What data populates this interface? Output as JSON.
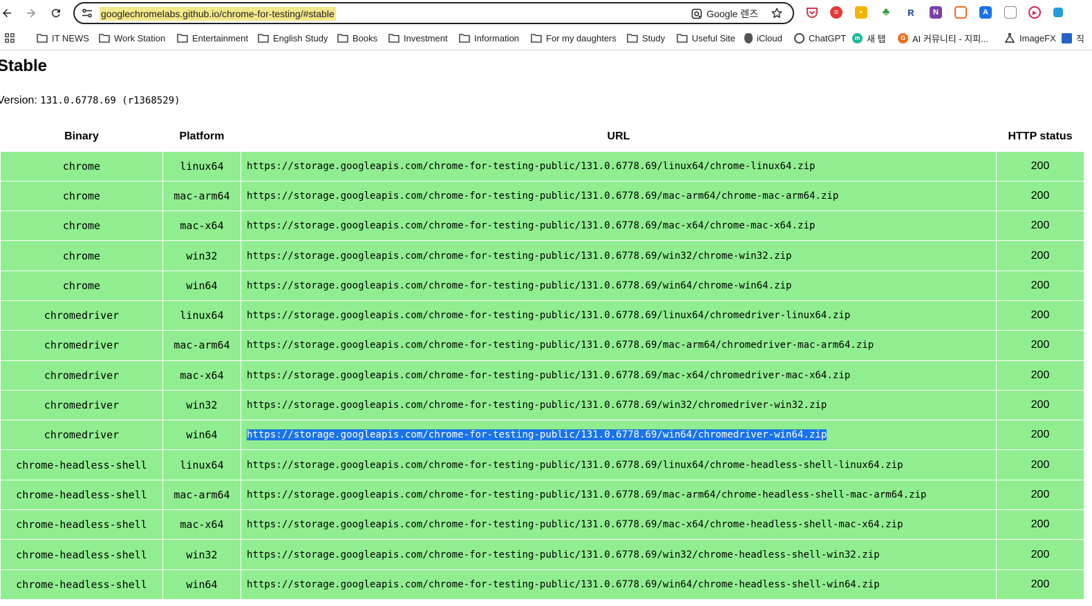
{
  "browser": {
    "address_bar": {
      "url": "googlechromelabs.github.io/chrome-for-testing/#stable"
    },
    "lens_label": "Google 렌즈"
  },
  "bookmarks": [
    {
      "label": "IT NEWS",
      "icon": "folder-icon"
    },
    {
      "label": "Work Station",
      "icon": "folder-icon"
    },
    {
      "label": "Entertainment",
      "icon": "folder-icon"
    },
    {
      "label": "English Study",
      "icon": "folder-icon"
    },
    {
      "label": "Books",
      "icon": "folder-icon"
    },
    {
      "label": "Investment",
      "icon": "folder-icon"
    },
    {
      "label": "Information",
      "icon": "folder-icon"
    },
    {
      "label": "For my daughters",
      "icon": "folder-icon"
    },
    {
      "label": "Study",
      "icon": "folder-icon"
    },
    {
      "label": "Useful Site",
      "icon": "folder-icon"
    },
    {
      "label": "iCloud",
      "icon": "apple-icon"
    },
    {
      "label": "ChatGPT",
      "icon": "openai-icon"
    },
    {
      "label": "새 탭",
      "icon": "m-icon"
    },
    {
      "label": "AI 커뮤니티 - 지피...",
      "icon": "community-icon"
    },
    {
      "label": "ImageFX",
      "icon": "flask-icon"
    },
    {
      "label": "직",
      "icon": "news-icon"
    }
  ],
  "page": {
    "title": "Stable",
    "version_prefix": "Version:",
    "version_value": "131.0.6778.69 (r1368529)",
    "table": {
      "headers": [
        "Binary",
        "Platform",
        "URL",
        "HTTP status"
      ],
      "rows": [
        {
          "binary": "chrome",
          "platform": "linux64",
          "url": "https://storage.googleapis.com/chrome-for-testing-public/131.0.6778.69/linux64/chrome-linux64.zip",
          "status": "200"
        },
        {
          "binary": "chrome",
          "platform": "mac-arm64",
          "url": "https://storage.googleapis.com/chrome-for-testing-public/131.0.6778.69/mac-arm64/chrome-mac-arm64.zip",
          "status": "200"
        },
        {
          "binary": "chrome",
          "platform": "mac-x64",
          "url": "https://storage.googleapis.com/chrome-for-testing-public/131.0.6778.69/mac-x64/chrome-mac-x64.zip",
          "status": "200"
        },
        {
          "binary": "chrome",
          "platform": "win32",
          "url": "https://storage.googleapis.com/chrome-for-testing-public/131.0.6778.69/win32/chrome-win32.zip",
          "status": "200"
        },
        {
          "binary": "chrome",
          "platform": "win64",
          "url": "https://storage.googleapis.com/chrome-for-testing-public/131.0.6778.69/win64/chrome-win64.zip",
          "status": "200"
        },
        {
          "binary": "chromedriver",
          "platform": "linux64",
          "url": "https://storage.googleapis.com/chrome-for-testing-public/131.0.6778.69/linux64/chromedriver-linux64.zip",
          "status": "200"
        },
        {
          "binary": "chromedriver",
          "platform": "mac-arm64",
          "url": "https://storage.googleapis.com/chrome-for-testing-public/131.0.6778.69/mac-arm64/chromedriver-mac-arm64.zip",
          "status": "200"
        },
        {
          "binary": "chromedriver",
          "platform": "mac-x64",
          "url": "https://storage.googleapis.com/chrome-for-testing-public/131.0.6778.69/mac-x64/chromedriver-mac-x64.zip",
          "status": "200"
        },
        {
          "binary": "chromedriver",
          "platform": "win32",
          "url": "https://storage.googleapis.com/chrome-for-testing-public/131.0.6778.69/win32/chromedriver-win32.zip",
          "status": "200"
        },
        {
          "binary": "chromedriver",
          "platform": "win64",
          "url": "https://storage.googleapis.com/chrome-for-testing-public/131.0.6778.69/win64/chromedriver-win64.zip",
          "status": "200",
          "selected": true
        },
        {
          "binary": "chrome-headless-shell",
          "platform": "linux64",
          "url": "https://storage.googleapis.com/chrome-for-testing-public/131.0.6778.69/linux64/chrome-headless-shell-linux64.zip",
          "status": "200"
        },
        {
          "binary": "chrome-headless-shell",
          "platform": "mac-arm64",
          "url": "https://storage.googleapis.com/chrome-for-testing-public/131.0.6778.69/mac-arm64/chrome-headless-shell-mac-arm64.zip",
          "status": "200"
        },
        {
          "binary": "chrome-headless-shell",
          "platform": "mac-x64",
          "url": "https://storage.googleapis.com/chrome-for-testing-public/131.0.6778.69/mac-x64/chrome-headless-shell-mac-x64.zip",
          "status": "200"
        },
        {
          "binary": "chrome-headless-shell",
          "platform": "win32",
          "url": "https://storage.googleapis.com/chrome-for-testing-public/131.0.6778.69/win32/chrome-headless-shell-win32.zip",
          "status": "200"
        },
        {
          "binary": "chrome-headless-shell",
          "platform": "win64",
          "url": "https://storage.googleapis.com/chrome-for-testing-public/131.0.6778.69/win64/chrome-headless-shell-win64.zip",
          "status": "200"
        }
      ]
    }
  },
  "colors": {
    "row_ok": "#90ee90",
    "selection": "#1a73e8",
    "url_highlight": "#f3e88a"
  }
}
